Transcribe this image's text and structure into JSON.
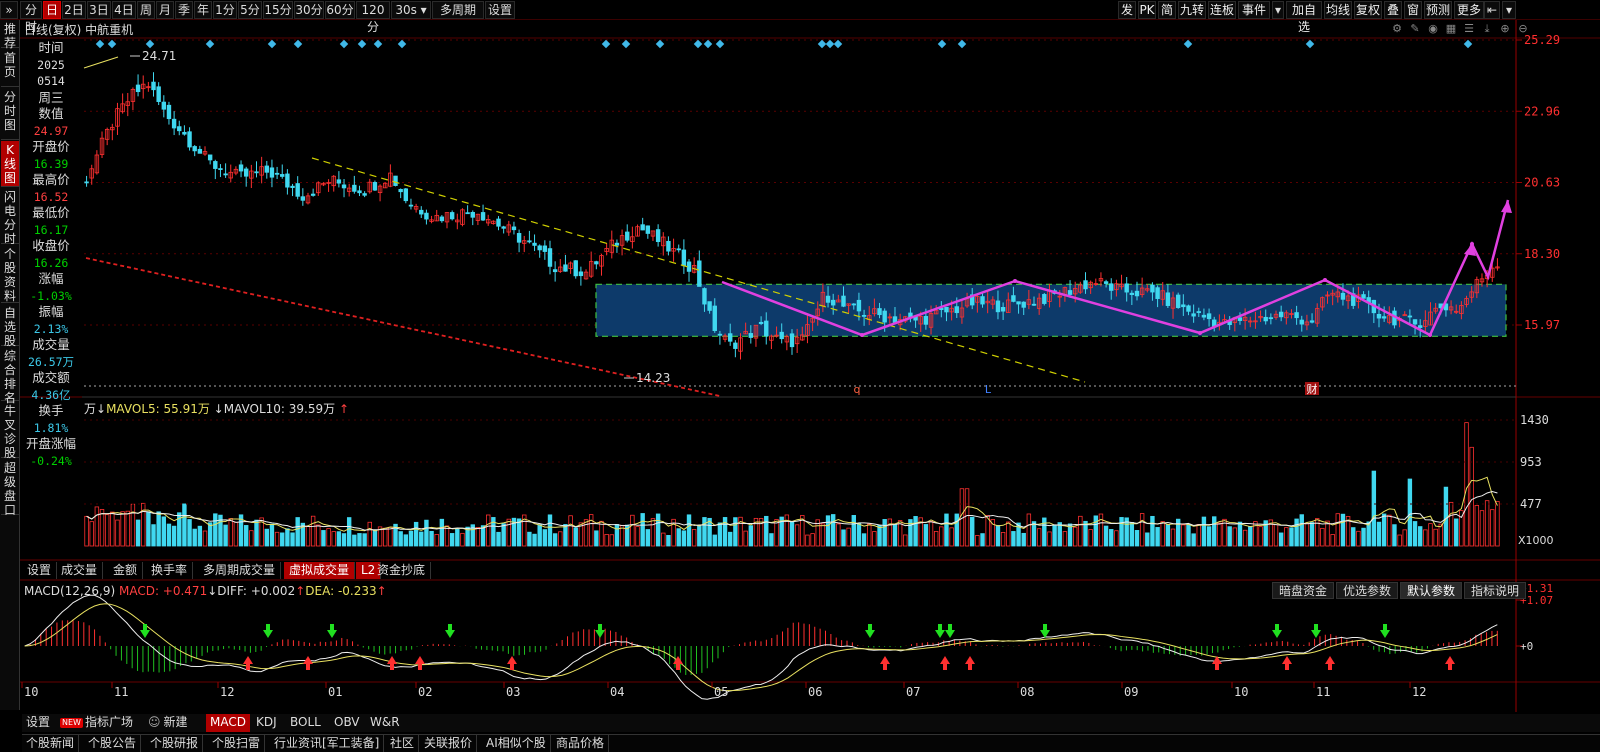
{
  "toolbar": {
    "items": [
      "分时",
      "日",
      "2日",
      "3日",
      "4日",
      "周",
      "月",
      "季",
      "年",
      "1分",
      "5分",
      "15分",
      "30分",
      "60分",
      "120分",
      "30s",
      "多周期",
      "设置"
    ],
    "active": "日",
    "right_items": [
      "发",
      "PK",
      "简",
      "九转",
      "连板",
      "事件",
      "加自选",
      "均线",
      "复权",
      "叠",
      "窗",
      "预测",
      "更多"
    ]
  },
  "left_nav": [
    "推荐",
    "首页",
    "分时图",
    "K线图",
    "闪电分时",
    "个股资料",
    "自选股",
    "综合排名",
    "牛叉诊股",
    "超级盘口"
  ],
  "left_nav_active": "K线图",
  "chart_title": "日线(复权)  中航重机",
  "info_panel": [
    {
      "label": "时间",
      "value": "2025",
      "color": "white"
    },
    {
      "label": "",
      "value": "0514",
      "color": "white"
    },
    {
      "label": "周三",
      "value": "",
      "color": "white"
    },
    {
      "label": "数值",
      "value": "24.97",
      "color": "red"
    },
    {
      "label": "开盘价",
      "value": "16.39",
      "color": "green"
    },
    {
      "label": "最高价",
      "value": "16.52",
      "color": "red"
    },
    {
      "label": "最低价",
      "value": "16.17",
      "color": "green"
    },
    {
      "label": "收盘价",
      "value": "16.26",
      "color": "green"
    },
    {
      "label": "涨幅",
      "value": "-1.03%",
      "color": "green"
    },
    {
      "label": "振幅",
      "value": "2.13%",
      "color": "cyan"
    },
    {
      "label": "成交量",
      "value": "26.57万",
      "color": "cyan"
    },
    {
      "label": "成交额",
      "value": "4.36亿",
      "color": "cyan"
    },
    {
      "label": "换手",
      "value": "1.81%",
      "color": "cyan"
    },
    {
      "label": "开盘涨幅",
      "value": "-0.24%",
      "color": "green"
    }
  ],
  "price_axis": {
    "ticks": [
      "25.29",
      "22.96",
      "20.63",
      "18.30",
      "15.97"
    ]
  },
  "annotations": {
    "high": "24.71",
    "low": "14.23",
    "event_marks": [
      "q",
      "L",
      "财"
    ]
  },
  "volume": {
    "header_prefix": "万",
    "mavol5_label": "MAVOL5: 55.91万",
    "mavol10_label": "MAVOL10: 39.59万",
    "ticks": [
      "1430",
      "953",
      "477"
    ],
    "unit": "X1000",
    "tabs": [
      "设置",
      "成交量",
      "金额",
      "换手率",
      "多周期成交量",
      "虚拟成交量",
      "L2",
      "资金抄底"
    ],
    "active_tab": "虚拟成交量"
  },
  "macd": {
    "name": "MACD(12,26,9)",
    "macd_label": "MACD: +0.471",
    "diff_label": "DIFF: +0.002",
    "dea_label": "DEA: -0.233",
    "ticks": [
      "+1.31",
      "+1.07",
      "+0"
    ],
    "buttons": [
      "暗盘资金",
      "优选参数",
      "默认参数",
      "指标说明"
    ],
    "active_button": "默认参数"
  },
  "time_axis": [
    "10",
    "11",
    "12",
    "01",
    "02",
    "03",
    "04",
    "05",
    "06",
    "07",
    "08",
    "09",
    "10",
    "11",
    "12"
  ],
  "indicator_tabs": [
    "设置",
    "指标广场",
    "新建",
    "MACD",
    "KDJ",
    "BOLL",
    "OBV",
    "W&R"
  ],
  "indicator_new_badge": "NEW",
  "active_indicator": "MACD",
  "news_tabs": [
    "个股新闻",
    "个股公告",
    "个股研报",
    "个股扫雷",
    "行业资讯[军工装备]",
    "社区",
    "关联报价",
    "AI相似个股",
    "商品价格"
  ],
  "colors": {
    "up": "#ff3030",
    "down": "#40d8f0",
    "magenta": "#e040e0",
    "yellow_trend": "#d0d000",
    "red_trend": "#e02020",
    "box": "#0d3a6a",
    "box_border": "#40c040"
  }
}
